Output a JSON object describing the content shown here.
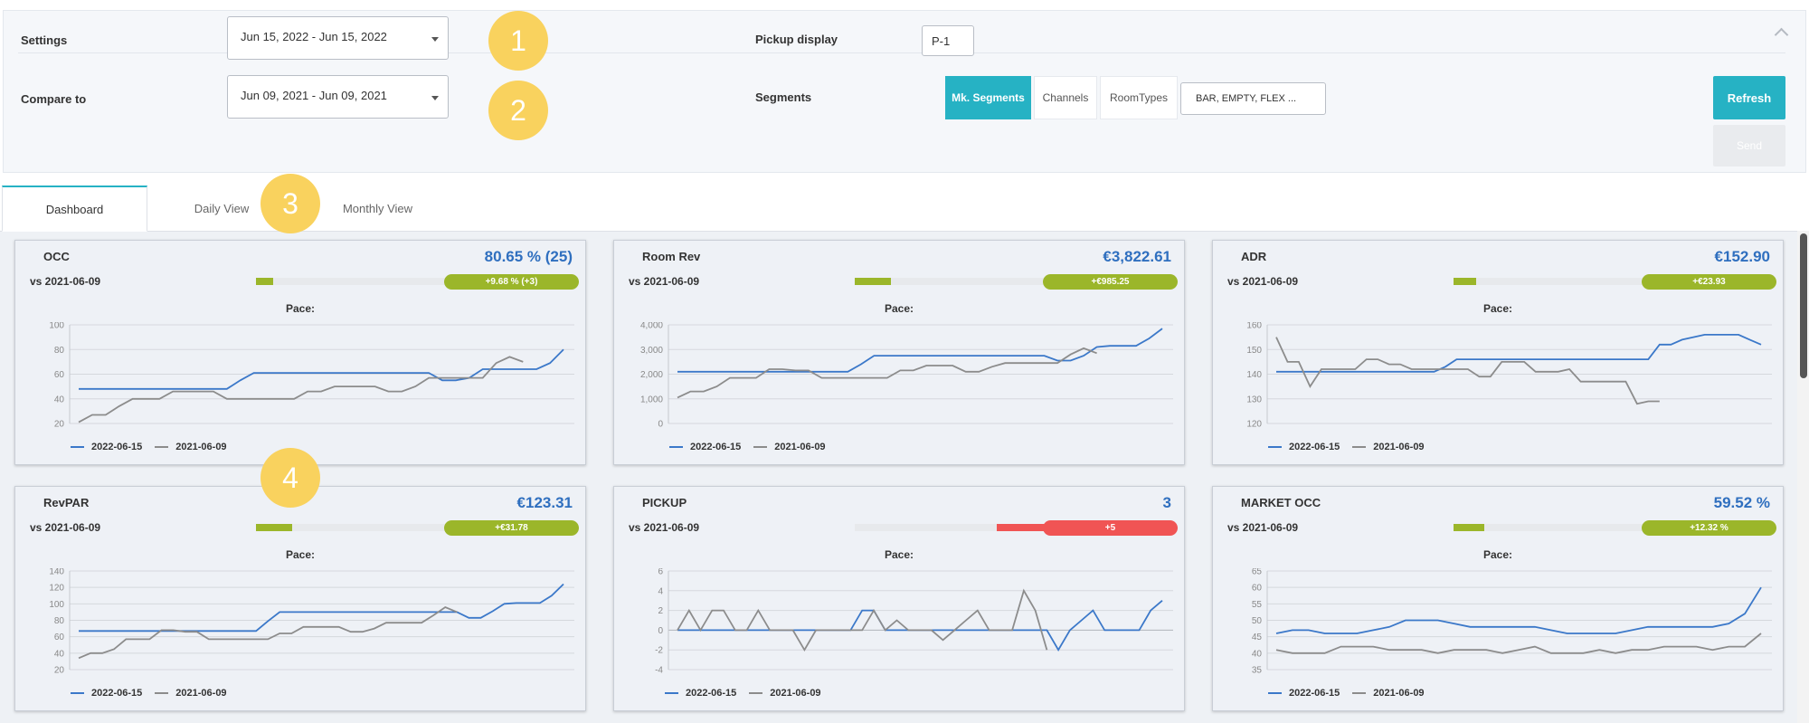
{
  "settings": {
    "settings_label": "Settings",
    "settings_range": "Jun 15, 2022 - Jun 15, 2022",
    "compare_label": "Compare to",
    "compare_range": "Jun 09, 2021 - Jun 09, 2021",
    "pickup_label": "Pickup display",
    "pickup_value": "P-1",
    "segments_label": "Segments",
    "segment_tabs": [
      "Mk. Segments",
      "Channels",
      "RoomTypes"
    ],
    "segment_select": "BAR, EMPTY, FLEX ...",
    "refresh_label": "Refresh",
    "send_label": "Send"
  },
  "badges": [
    "1",
    "2",
    "3",
    "4"
  ],
  "tabs": [
    "Dashboard",
    "Daily View",
    "Monthly View"
  ],
  "colors": {
    "accent": "#26b2c4",
    "current": "#3b78c9",
    "previous": "#8c8c8c",
    "positive": "#9bb62a",
    "negative": "#f05454",
    "value": "#2f6fbf"
  },
  "cards": [
    {
      "title": "OCC",
      "value": "80.65 % (25)",
      "vs": "vs 2021-06-09",
      "delta": "+9.68 % (+3)",
      "trend": "positive",
      "progress": 0.09,
      "pace": "Pace:"
    },
    {
      "title": "Room Rev",
      "value": "€3,822.61",
      "vs": "vs 2021-06-09",
      "delta": "+€985.25",
      "trend": "positive",
      "progress": 0.19,
      "pace": "Pace:"
    },
    {
      "title": "ADR",
      "value": "€152.90",
      "vs": "vs 2021-06-09",
      "delta": "+€23.93",
      "trend": "positive",
      "progress": 0.12,
      "pace": "Pace:"
    },
    {
      "title": "RevPAR",
      "value": "€123.31",
      "vs": "vs 2021-06-09",
      "delta": "+€31.78",
      "trend": "positive",
      "progress": 0.19,
      "pace": "Pace:"
    },
    {
      "title": "PICKUP",
      "value": "3",
      "vs": "vs 2021-06-09",
      "delta": "+5",
      "trend": "negative",
      "progress": 0.25,
      "pace": "Pace:"
    },
    {
      "title": "MARKET OCC",
      "value": "59.52 %",
      "vs": "vs 2021-06-09",
      "delta": "+12.32 %",
      "trend": "positive",
      "progress": 0.16,
      "pace": "Pace:"
    }
  ],
  "chart_data": [
    {
      "type": "line",
      "title": "OCC",
      "ylim": [
        20,
        100
      ],
      "yticks": [
        "100",
        "80",
        "60",
        "40",
        "20"
      ],
      "yvals": [
        100,
        80,
        60,
        40,
        20
      ],
      "series": [
        {
          "name": "2022-06-15",
          "values": [
            48,
            48,
            48,
            48,
            48,
            48,
            48,
            48,
            48,
            48,
            48,
            48,
            55,
            61,
            61,
            61,
            61,
            61,
            61,
            61,
            61,
            61,
            61,
            61,
            61,
            61,
            61,
            55,
            55,
            57,
            64,
            64,
            64,
            64,
            64,
            69,
            80
          ]
        },
        {
          "name": "2021-06-09",
          "values": [
            21,
            27,
            27,
            34,
            40,
            40,
            40,
            46,
            46,
            46,
            46,
            40,
            40,
            40,
            40,
            40,
            40,
            46,
            46,
            50,
            50,
            50,
            50,
            46,
            46,
            50,
            57,
            57,
            57,
            57,
            57,
            69,
            74,
            70
          ]
        }
      ]
    },
    {
      "type": "line",
      "title": "Room Rev",
      "ylim": [
        0,
        4000
      ],
      "yticks": [
        "4,000",
        "3,000",
        "2,000",
        "1,000",
        "0"
      ],
      "yvals": [
        4000,
        3000,
        2000,
        1000,
        0
      ],
      "series": [
        {
          "name": "2022-06-15",
          "values": [
            2100,
            2100,
            2100,
            2100,
            2100,
            2100,
            2100,
            2100,
            2100,
            2100,
            2100,
            2100,
            2100,
            2100,
            2400,
            2750,
            2750,
            2750,
            2750,
            2750,
            2750,
            2750,
            2750,
            2750,
            2750,
            2750,
            2750,
            2750,
            2750,
            2550,
            2550,
            2750,
            3100,
            3150,
            3150,
            3150,
            3450,
            3850
          ]
        },
        {
          "name": "2021-06-09",
          "values": [
            1050,
            1300,
            1300,
            1500,
            1850,
            1850,
            1850,
            2200,
            2200,
            2150,
            2150,
            1850,
            1850,
            1850,
            1850,
            1850,
            1850,
            2150,
            2150,
            2350,
            2350,
            2350,
            2100,
            2100,
            2300,
            2450,
            2450,
            2450,
            2450,
            2450,
            2800,
            3050,
            2850
          ]
        }
      ]
    },
    {
      "type": "line",
      "title": "ADR",
      "ylim": [
        120,
        160
      ],
      "yticks": [
        "160",
        "150",
        "140",
        "130",
        "120"
      ],
      "yvals": [
        160,
        150,
        140,
        130,
        120
      ],
      "series": [
        {
          "name": "2022-06-15",
          "values": [
            141,
            141,
            141,
            141,
            141,
            141,
            141,
            141,
            141,
            141,
            141,
            141,
            141,
            141,
            141,
            143,
            146,
            146,
            146,
            146,
            146,
            146,
            146,
            146,
            146,
            146,
            146,
            146,
            146,
            146,
            146,
            146,
            146,
            146,
            152,
            152,
            154,
            155,
            156,
            156,
            156,
            156,
            154,
            152
          ]
        },
        {
          "name": "2021-06-09",
          "values": [
            155,
            145,
            145,
            135,
            142,
            142,
            142,
            142,
            146,
            146,
            144,
            144,
            142,
            142,
            142,
            142,
            142,
            142,
            139,
            139,
            145,
            145,
            145,
            141,
            141,
            141,
            142,
            137,
            137,
            137,
            137,
            137,
            128,
            129,
            129
          ]
        }
      ]
    },
    {
      "type": "line",
      "title": "RevPAR",
      "ylim": [
        20,
        140
      ],
      "yticks": [
        "140",
        "120",
        "100",
        "80",
        "60",
        "40",
        "20"
      ],
      "yvals": [
        140,
        120,
        100,
        80,
        60,
        40,
        20
      ],
      "series": [
        {
          "name": "2022-06-15",
          "values": [
            67,
            67,
            67,
            67,
            67,
            67,
            67,
            67,
            67,
            67,
            67,
            67,
            67,
            67,
            67,
            67,
            79,
            90,
            90,
            90,
            90,
            90,
            90,
            90,
            90,
            90,
            90,
            90,
            90,
            90,
            90,
            90,
            90,
            83,
            83,
            91,
            100,
            101,
            101,
            101,
            110,
            124
          ]
        },
        {
          "name": "2021-06-09",
          "values": [
            34,
            40,
            40,
            45,
            57,
            57,
            57,
            68,
            68,
            66,
            66,
            57,
            57,
            57,
            57,
            57,
            57,
            64,
            64,
            72,
            72,
            72,
            72,
            66,
            66,
            70,
            77,
            77,
            77,
            77,
            86,
            96,
            90
          ]
        }
      ]
    },
    {
      "type": "line",
      "title": "PICKUP",
      "ylim": [
        -4,
        6
      ],
      "yticks": [
        "6",
        "4",
        "2",
        "0",
        "-2",
        "-4"
      ],
      "yvals": [
        6,
        4,
        2,
        0,
        -2,
        -4
      ],
      "series": [
        {
          "name": "2022-06-15",
          "values": [
            0,
            0,
            0,
            0,
            0,
            0,
            0,
            0,
            0,
            0,
            0,
            0,
            0,
            0,
            0,
            0,
            2,
            2,
            0,
            0,
            0,
            0,
            0,
            0,
            0,
            0,
            0,
            0,
            0,
            0,
            0,
            0,
            0,
            -2,
            0,
            1,
            2,
            0,
            0,
            0,
            0,
            2,
            3
          ]
        },
        {
          "name": "2021-06-09",
          "values": [
            0,
            2,
            0,
            2,
            2,
            0,
            0,
            2,
            0,
            0,
            0,
            -2,
            0,
            0,
            0,
            0,
            0,
            2,
            0,
            1,
            0,
            0,
            0,
            -1,
            0,
            1,
            2,
            0,
            0,
            0,
            4,
            2,
            -2
          ]
        }
      ]
    },
    {
      "type": "line",
      "title": "MARKET OCC",
      "ylim": [
        35,
        65
      ],
      "yticks": [
        "65",
        "60",
        "55",
        "50",
        "45",
        "40",
        "35"
      ],
      "yvals": [
        65,
        60,
        55,
        50,
        45,
        40,
        35
      ],
      "series": [
        {
          "name": "2022-06-15",
          "values": [
            46,
            47,
            47,
            46,
            46,
            46,
            47,
            48,
            50,
            50,
            50,
            49,
            48,
            48,
            48,
            48,
            48,
            47,
            46,
            46,
            46,
            46,
            47,
            48,
            48,
            48,
            48,
            48,
            49,
            52,
            60
          ]
        },
        {
          "name": "2021-06-09",
          "values": [
            41,
            40,
            40,
            40,
            42,
            42,
            42,
            41,
            41,
            41,
            40,
            41,
            41,
            41,
            40,
            41,
            42,
            40,
            40,
            40,
            41,
            40,
            41,
            41,
            42,
            42,
            42,
            41,
            42,
            42,
            46
          ]
        }
      ]
    }
  ]
}
